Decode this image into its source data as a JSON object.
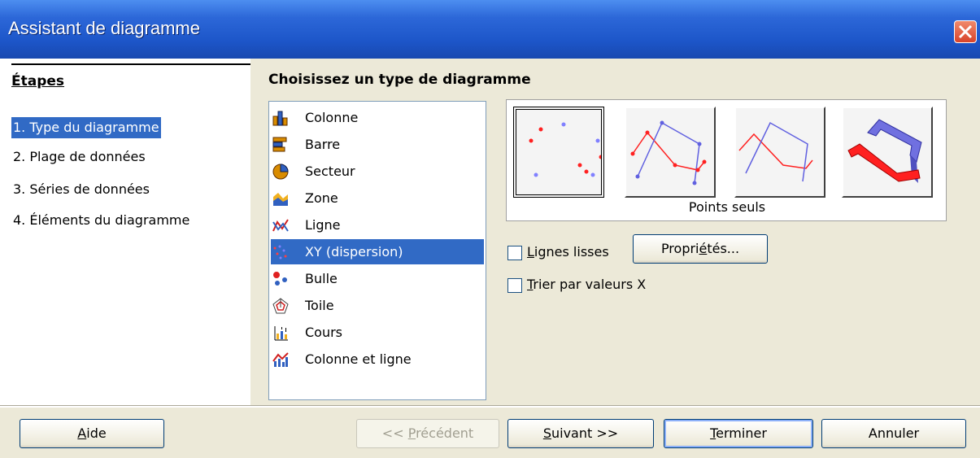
{
  "window": {
    "title": "Assistant de diagramme"
  },
  "sidebar": {
    "heading": "Étapes",
    "steps": [
      {
        "label": "1. Type du diagramme",
        "active": true
      },
      {
        "label": "2. Plage de données"
      },
      {
        "label": "3. Séries de données"
      },
      {
        "label": "4. Éléments du diagramme"
      }
    ]
  },
  "main": {
    "heading": "Choisissez un type de diagramme",
    "chart_types": [
      {
        "label": "Colonne",
        "icon": "column-chart-icon"
      },
      {
        "label": "Barre",
        "icon": "bar-chart-icon"
      },
      {
        "label": "Secteur",
        "icon": "pie-chart-icon"
      },
      {
        "label": "Zone",
        "icon": "area-chart-icon"
      },
      {
        "label": "Ligne",
        "icon": "line-chart-icon"
      },
      {
        "label": "XY (dispersion)",
        "icon": "scatter-chart-icon",
        "selected": true
      },
      {
        "label": "Bulle",
        "icon": "bubble-chart-icon"
      },
      {
        "label": "Toile",
        "icon": "net-chart-icon"
      },
      {
        "label": "Cours",
        "icon": "stock-chart-icon"
      },
      {
        "label": "Colonne et ligne",
        "icon": "column-line-chart-icon"
      }
    ],
    "variant_label": "Points seuls",
    "options": {
      "smooth_lines": {
        "prefix": "",
        "mnemonic": "L",
        "rest": "ignes lisses",
        "checked": false
      },
      "sort_x": {
        "mnemonic": "T",
        "rest": "rier par valeurs X",
        "checked": false
      },
      "properties": {
        "prefix": "Propri",
        "mnemonic": "é",
        "rest": "tés..."
      }
    }
  },
  "buttons": {
    "help": {
      "mnemonic": "A",
      "rest": "ide"
    },
    "previous": {
      "prefix": "<< ",
      "mnemonic": "P",
      "rest": "récédent"
    },
    "next": {
      "mnemonic": "S",
      "rest": "uivant >>"
    },
    "finish": {
      "mnemonic": "T",
      "rest": "erminer"
    },
    "cancel": {
      "label": "Annuler"
    }
  },
  "colors": {
    "title_bar": "#2c67d8",
    "selection": "#316ac5",
    "dialog_bg": "#ece9d8"
  }
}
